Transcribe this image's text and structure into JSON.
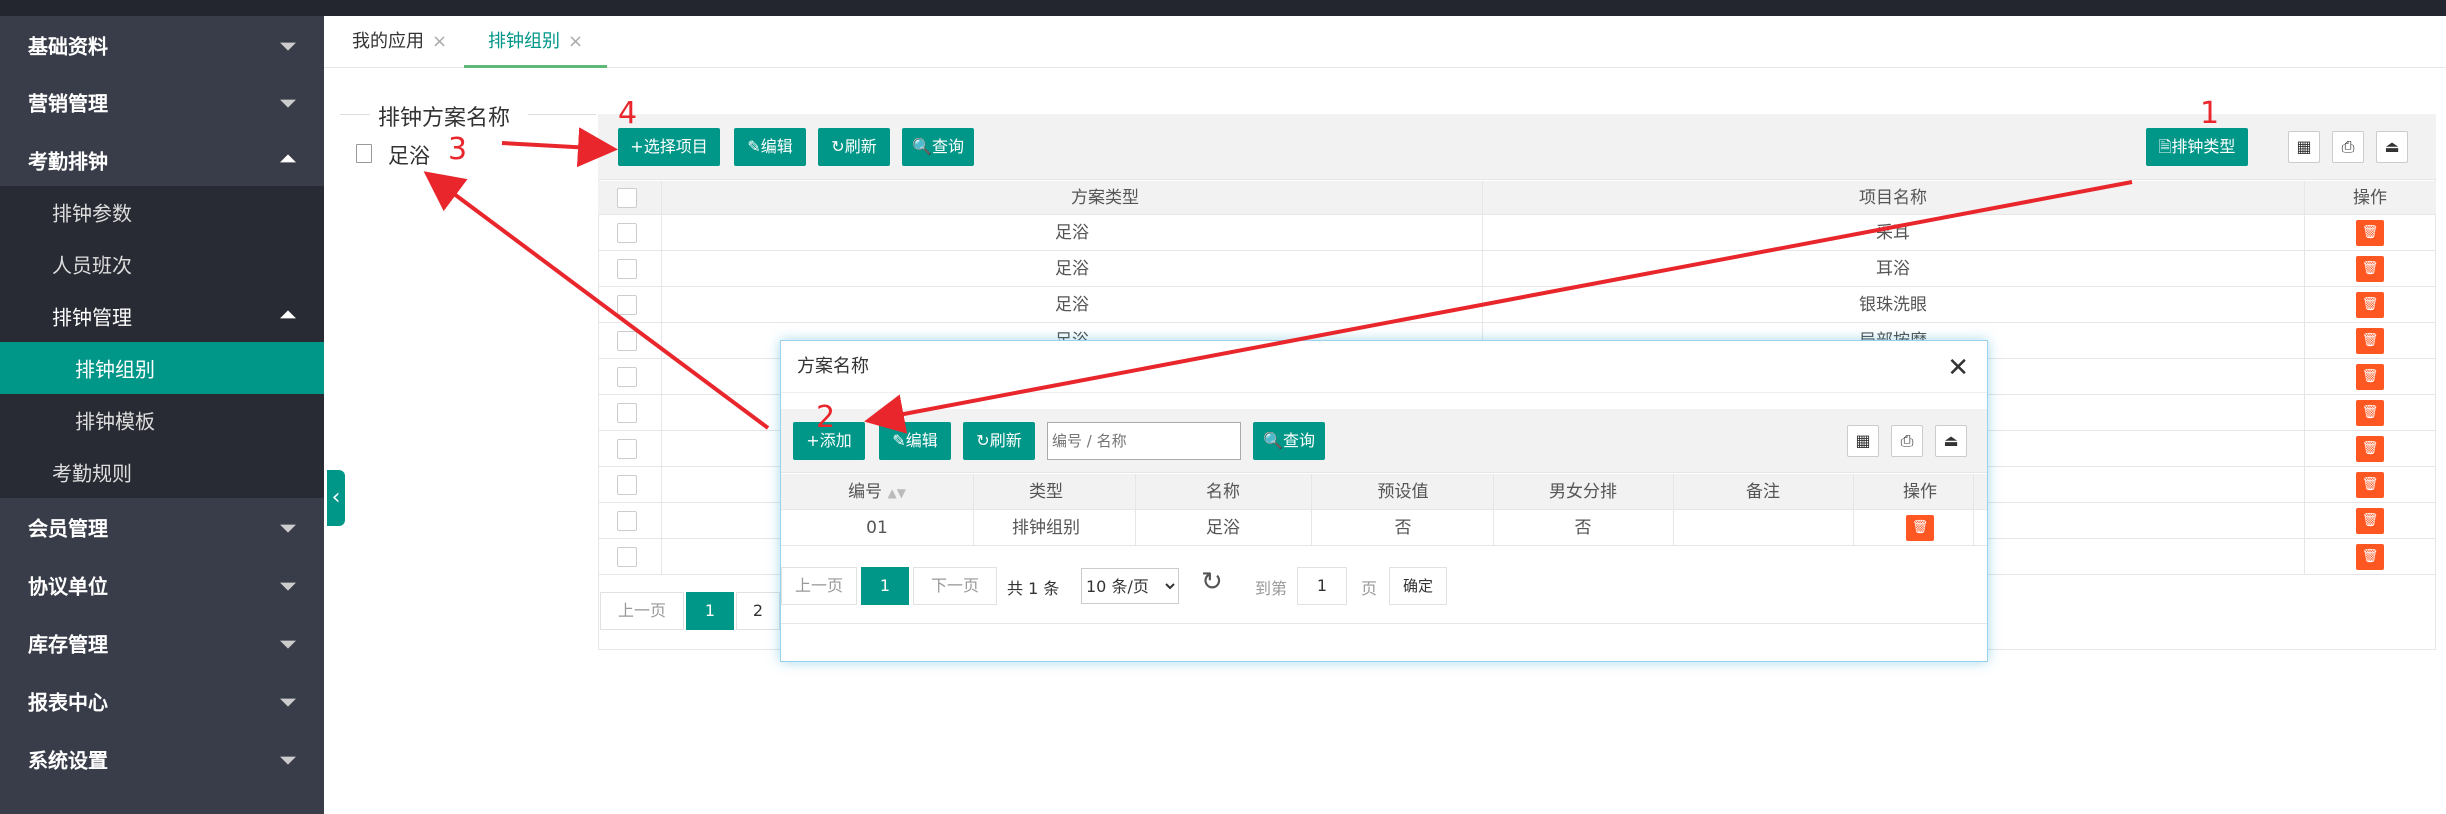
{
  "sidebar": {
    "menus": [
      {
        "label": "基础资料",
        "expanded": false
      },
      {
        "label": "营销管理",
        "expanded": false
      },
      {
        "label": "考勤排钟",
        "expanded": true
      },
      {
        "label": "会员管理",
        "expanded": false
      },
      {
        "label": "协议单位",
        "expanded": false
      },
      {
        "label": "库存管理",
        "expanded": false
      },
      {
        "label": "报表中心",
        "expanded": false
      },
      {
        "label": "系统设置",
        "expanded": false
      }
    ],
    "subitems": [
      "排钟参数",
      "人员班次",
      "排钟管理",
      "排钟组别",
      "排钟模板",
      "考勤规则"
    ],
    "active_subitem": "排钟组别"
  },
  "tabs": [
    {
      "label": "我的应用",
      "close": "×"
    },
    {
      "label": "排钟组别",
      "close": "×",
      "active": true
    }
  ],
  "tree": {
    "title": "排钟方案名称",
    "nodes": [
      "足浴"
    ]
  },
  "toolbar": {
    "select_items": "+选择项目",
    "edit": "✎编辑",
    "refresh": "↻刷新",
    "query": "🔍查询",
    "schedule_type": "🗎排钟类型"
  },
  "grid": {
    "headers": [
      "方案类型",
      "项目名称",
      "操作"
    ],
    "rows": [
      [
        "足浴",
        "采耳"
      ],
      [
        "足浴",
        "耳浴"
      ],
      [
        "足浴",
        "银珠洗眼"
      ],
      [
        "足浴",
        "局部按摩"
      ],
      [
        "",
        ""
      ],
      [
        "",
        ""
      ],
      [
        "",
        ""
      ],
      [
        "",
        ""
      ],
      [
        "",
        ""
      ],
      [
        "",
        ""
      ]
    ],
    "pager": {
      "prev": "上一页",
      "pages": [
        "1",
        "2"
      ]
    }
  },
  "dialog": {
    "title": "方案名称",
    "close": "✕",
    "add": "+添加",
    "edit": "✎编辑",
    "refresh": "↻刷新",
    "search_placeholder": "编号 / 名称",
    "query": "🔍查询",
    "headers": [
      "编号",
      "类型",
      "名称",
      "预设值",
      "男女分排",
      "备注",
      "操作"
    ],
    "rows": [
      [
        "01",
        "排钟组别",
        "足浴",
        "否",
        "否",
        ""
      ]
    ],
    "pager": {
      "prev": "上一页",
      "current": "1",
      "next": "下一页",
      "total": "共 1 条",
      "page_size": "10 条/页",
      "goto": "到第",
      "goto_value": "1",
      "page_unit": "页",
      "confirm": "确定"
    }
  },
  "annotations": [
    "1",
    "2",
    "3",
    "4"
  ],
  "colors": {
    "accent": "#009688",
    "danger": "#ff5722",
    "sidebar": "#393d49",
    "annotation": "#e8262b"
  }
}
